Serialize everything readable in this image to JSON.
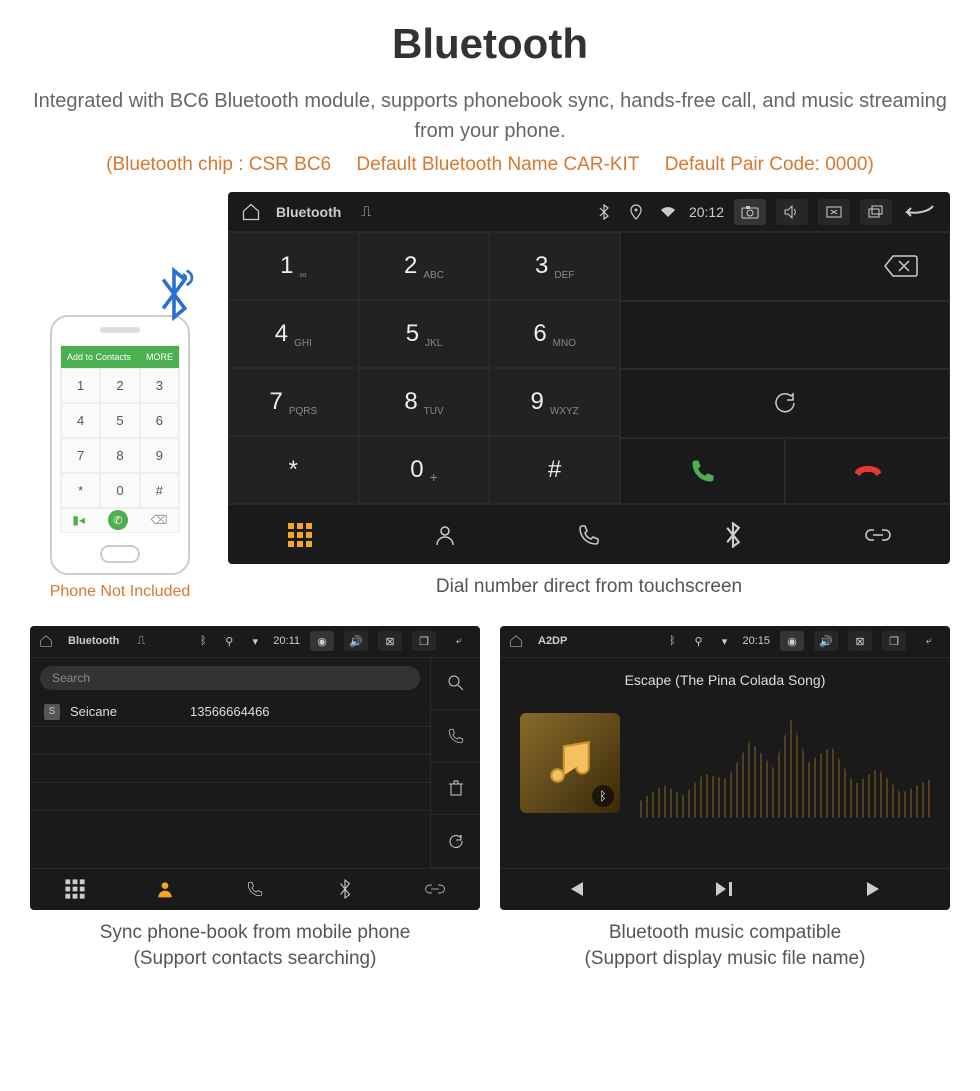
{
  "header": {
    "title": "Bluetooth",
    "description": "Integrated with BC6 Bluetooth module, supports phonebook sync, hands-free call, and music streaming from your phone.",
    "spec_chip": "(Bluetooth chip : CSR BC6",
    "spec_name": "Default Bluetooth Name CAR-KIT",
    "spec_code": "Default Pair Code: 0000)"
  },
  "phone": {
    "header_left": "Add to Contacts",
    "header_right": "MORE",
    "keys": [
      "1",
      "2",
      "3",
      "4",
      "5",
      "6",
      "7",
      "8",
      "9",
      "*",
      "0",
      "#"
    ],
    "label": "Phone Not Included"
  },
  "dialer": {
    "statusbar": {
      "title": "Bluetooth",
      "time": "20:12"
    },
    "keys": [
      {
        "n": "1",
        "s": "∞"
      },
      {
        "n": "2",
        "s": "ABC"
      },
      {
        "n": "3",
        "s": "DEF"
      },
      {
        "n": "4",
        "s": "GHI"
      },
      {
        "n": "5",
        "s": "JKL"
      },
      {
        "n": "6",
        "s": "MNO"
      },
      {
        "n": "7",
        "s": "PQRS"
      },
      {
        "n": "8",
        "s": "TUV"
      },
      {
        "n": "9",
        "s": "WXYZ"
      },
      {
        "n": "*",
        "s": ""
      },
      {
        "n": "0",
        "s": "+"
      },
      {
        "n": "#",
        "s": ""
      }
    ],
    "caption": "Dial number direct from touchscreen"
  },
  "contacts": {
    "statusbar": {
      "title": "Bluetooth",
      "time": "20:11"
    },
    "search_placeholder": "Search",
    "row": {
      "badge": "S",
      "name": "Seicane",
      "number": "13566664466"
    },
    "caption1": "Sync phone-book from mobile phone",
    "caption2": "(Support contacts searching)"
  },
  "music": {
    "statusbar": {
      "title": "A2DP",
      "time": "20:15"
    },
    "track": "Escape (The Pina Colada Song)",
    "caption1": "Bluetooth music compatible",
    "caption2": "(Support display music file name)"
  }
}
